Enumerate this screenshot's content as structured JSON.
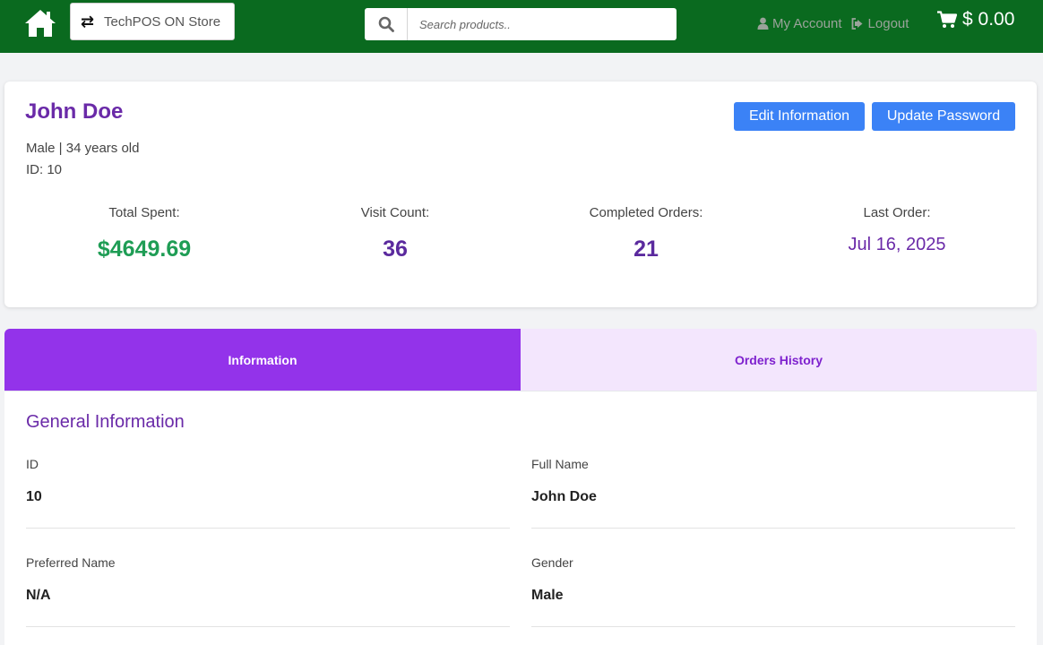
{
  "navbar": {
    "store_label": "TechPOS ON Store",
    "search_placeholder": "Search products..",
    "my_account": "My Account",
    "logout": "Logout",
    "cart_total": "$ 0.00",
    "bg_color": "#0a6a1f"
  },
  "profile": {
    "name": "John Doe",
    "gender_age": "Male | 34 years old",
    "id_line": "ID: 10",
    "edit_button": "Edit Information",
    "password_button": "Update Password",
    "stats": [
      {
        "label": "Total Spent:",
        "value": "$4649.69"
      },
      {
        "label": "Visit Count:",
        "value": "36"
      },
      {
        "label": "Completed Orders:",
        "value": "21"
      },
      {
        "label": "Last Order:",
        "value": "Jul 16, 2025"
      }
    ]
  },
  "tabs": [
    {
      "label": "Information",
      "active": true
    },
    {
      "label": "Orders History",
      "active": false
    }
  ],
  "general": {
    "title": "General Information",
    "fields": [
      {
        "label": "ID",
        "value": "10"
      },
      {
        "label": "Full Name",
        "value": "John Doe"
      },
      {
        "label": "Preferred Name",
        "value": "N/A"
      },
      {
        "label": "Gender",
        "value": "Male"
      }
    ]
  },
  "colors": {
    "accent_purple": "#9333ea",
    "title_purple": "#6a2aa8",
    "money_green": "#1f9d55",
    "button_blue": "#3b82f6"
  }
}
